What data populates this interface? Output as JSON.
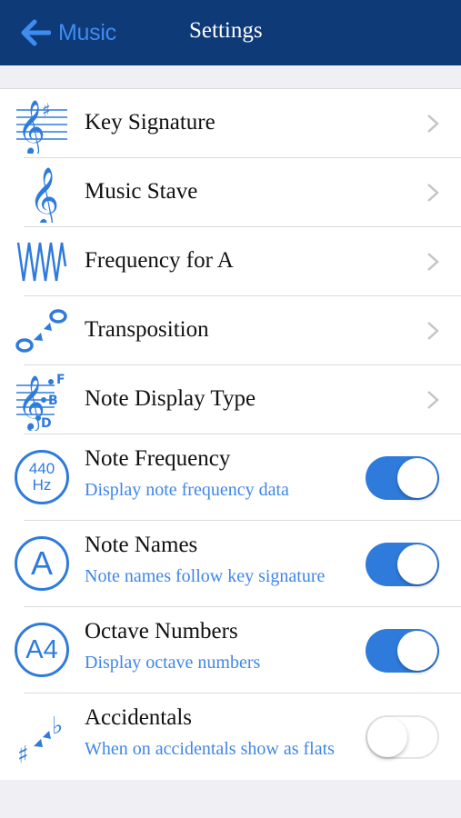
{
  "navbar": {
    "back_label": "Music",
    "title": "Settings"
  },
  "colors": {
    "navbar": "#0e3a78",
    "accent": "#2f7bdc",
    "back_text": "#3f8cf0",
    "background": "#efeff4"
  },
  "nav_rows": [
    {
      "label": "Key Signature",
      "icon": "key-signature-icon"
    },
    {
      "label": "Music Stave",
      "icon": "treble-clef-icon"
    },
    {
      "label": "Frequency for A",
      "icon": "waveform-icon"
    },
    {
      "label": "Transposition",
      "icon": "transposition-icon"
    },
    {
      "label": "Note Display Type",
      "icon": "note-display-icon"
    }
  ],
  "toggle_rows": [
    {
      "label": "Note Frequency",
      "subtitle": "Display note frequency data",
      "icon": "frequency-440hz-icon",
      "icon_text_top": "440",
      "icon_text_bottom": "Hz",
      "on": true
    },
    {
      "label": "Note Names",
      "subtitle": "Note names follow key signature",
      "icon": "note-name-a-icon",
      "icon_text": "A",
      "on": true
    },
    {
      "label": "Octave Numbers",
      "subtitle": "Display octave numbers",
      "icon": "octave-a4-icon",
      "icon_text": "A4",
      "on": true
    },
    {
      "label": "Accidentals",
      "subtitle": "When on accidentals show as flats",
      "icon": "accidentals-icon",
      "on": false
    }
  ],
  "note_display_letters": [
    "F",
    "B",
    "D"
  ]
}
